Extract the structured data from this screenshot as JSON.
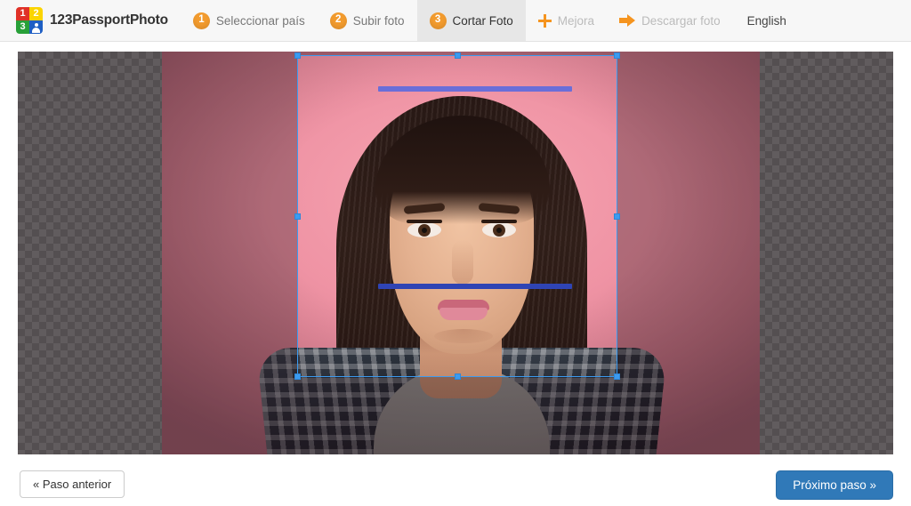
{
  "brand": {
    "name": "123PassportPhoto",
    "logo_cells": [
      {
        "label": "1",
        "color": "#e03127"
      },
      {
        "label": "2",
        "color": "#fbd400"
      },
      {
        "label": "3",
        "color": "#28a038"
      },
      {
        "label": "",
        "color": "#1f5fc4",
        "icon": "person-icon"
      }
    ]
  },
  "nav": {
    "items": [
      {
        "badge": "1",
        "label": "Seleccionar país",
        "state": "done",
        "icon": "step-badge-icon"
      },
      {
        "badge": "2",
        "label": "Subir foto",
        "state": "done",
        "icon": "step-badge-icon"
      },
      {
        "badge": "3",
        "label": "Cortar Foto",
        "state": "active",
        "icon": "step-badge-icon"
      },
      {
        "badge": "",
        "label": "Mejora",
        "state": "disabled",
        "icon": "plus-icon"
      },
      {
        "badge": "",
        "label": "Descargar foto",
        "state": "disabled",
        "icon": "arrow-right-icon"
      }
    ],
    "language": "English"
  },
  "editor": {
    "canvas_background": "transparent-checkerboard",
    "crop": {
      "tool": "crop-selection",
      "handles": [
        "top-left",
        "top-center",
        "top-right",
        "middle-left",
        "middle-right",
        "bottom-left",
        "bottom-center",
        "bottom-right"
      ],
      "accent_color": "#3b9bf0"
    },
    "guides": [
      {
        "name": "head-top-guide",
        "color": "#6a6ed8"
      },
      {
        "name": "chin-guide",
        "color": "#2f44b4"
      }
    ],
    "photo_alt": "passport-photo-subject"
  },
  "footer": {
    "prev_label": "« Paso anterior",
    "next_label": "Próximo paso »",
    "next_color": "#3079b8"
  }
}
